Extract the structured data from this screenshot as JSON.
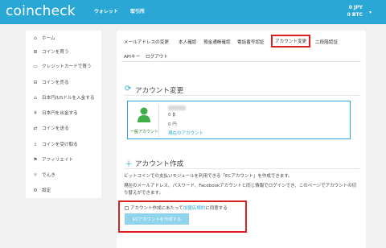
{
  "header": {
    "logo": "coincheck",
    "nav": [
      "ウォレット",
      "取引所"
    ],
    "balance_jpy": "0 JPY",
    "balance_btc": "0 BTC",
    "caret": "▾"
  },
  "sidebar": {
    "items": [
      {
        "icon": "home-icon",
        "glyph": "⌂",
        "label": "ホーム"
      },
      {
        "icon": "cart-icon",
        "glyph": "⊞",
        "label": "コインを買う"
      },
      {
        "icon": "credit-card-icon",
        "glyph": "▭",
        "label": "クレジットカードで買う"
      },
      {
        "icon": "sell-icon",
        "glyph": "⊟",
        "label": "コインを売る"
      },
      {
        "icon": "bank-icon",
        "glyph": "⌂",
        "label": "日本円/USドルを入金する"
      },
      {
        "icon": "yen-icon",
        "glyph": "¥",
        "label": "日本円を出金する"
      },
      {
        "icon": "send-icon",
        "glyph": "⇄",
        "label": "コインを送る"
      },
      {
        "icon": "receive-icon",
        "glyph": "⤓",
        "label": "コインを受け取る"
      },
      {
        "icon": "affiliate-icon",
        "glyph": "⚑",
        "label": "アフィリエイト"
      },
      {
        "icon": "lightbulb-icon",
        "glyph": "☼",
        "label": "でんき"
      },
      {
        "icon": "gear-icon",
        "glyph": "⚙",
        "label": "設定"
      }
    ]
  },
  "tabs": [
    {
      "label": "メールアドレスの変更"
    },
    {
      "label": "本人確認"
    },
    {
      "label": "預金通帳確認"
    },
    {
      "label": "電話番号認証"
    },
    {
      "label": "アカウント変更",
      "active": true
    },
    {
      "label": "二段階認証"
    },
    {
      "label": "APIキー"
    },
    {
      "label": "ログアウト"
    }
  ],
  "account_change": {
    "title": "アカウント変更",
    "type_label": "一般アカウント",
    "balance_btc": "0 ₿",
    "balance_jpy": "0 円",
    "current_account_link": "現在のアカウント"
  },
  "account_create": {
    "title": "アカウント作成",
    "para1": "ビットコインでの支払いモジュールを利用できる「ECアカウント」を作成できます。",
    "para2": "現在のメールアドレス、パスワード、Facebookアカウントと同じ情報でログインでき、このページでアカウントの切り替えができます。",
    "agree_prefix": "アカウント作成にあたって",
    "agree_link": "加盟店規約",
    "agree_suffix": "に同意する",
    "button": "ECアカウントを作成する"
  },
  "colors": {
    "brand": "#2ba7d6",
    "highlight": "#e02020",
    "account_icon": "#3fae49"
  }
}
